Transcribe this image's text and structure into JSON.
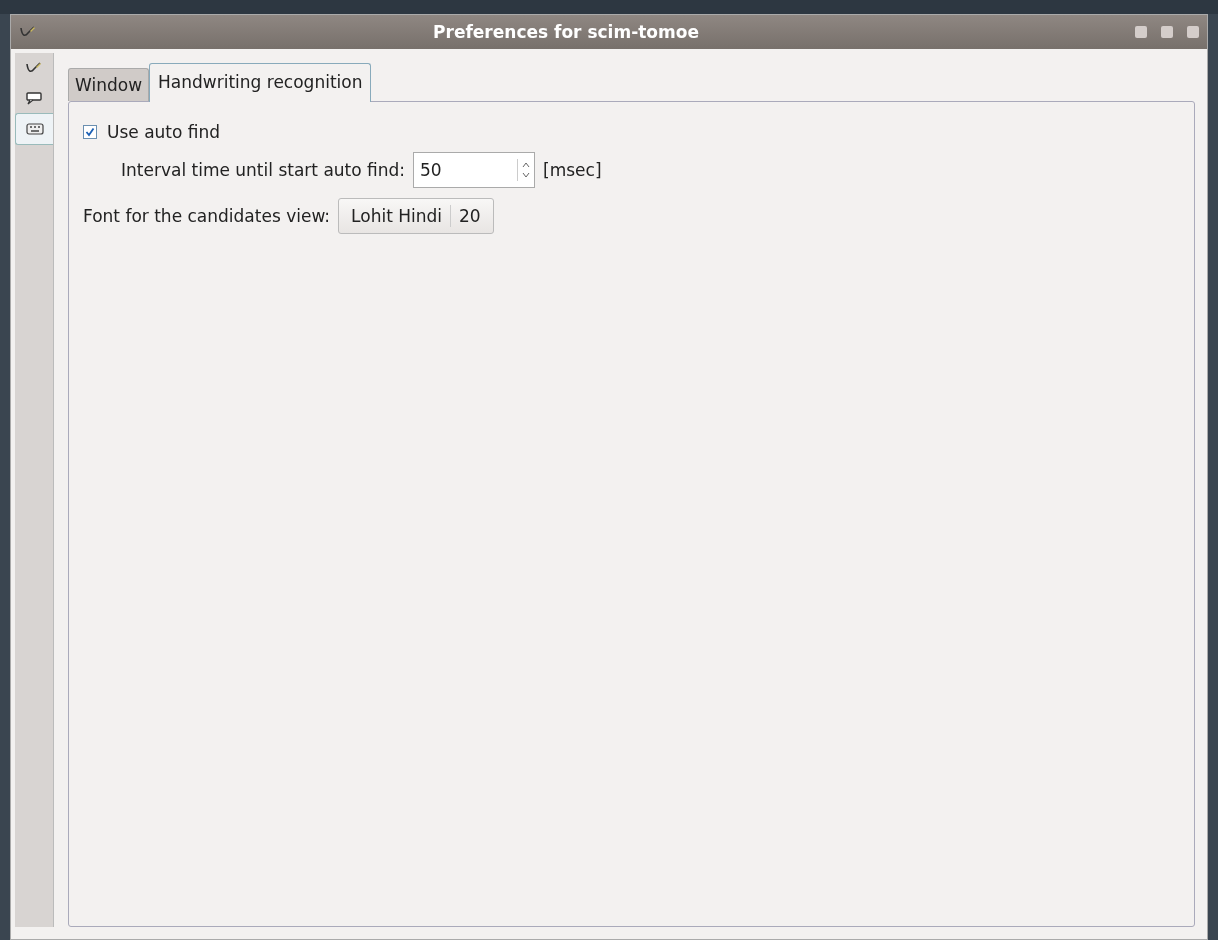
{
  "window": {
    "title": "Preferences for scim-tomoe"
  },
  "side_tabs": [
    {
      "kind": "pen",
      "selected": false
    },
    {
      "kind": "balloon",
      "selected": false
    },
    {
      "kind": "keyboard",
      "selected": true
    }
  ],
  "tabs": [
    {
      "label": "Window",
      "selected": false
    },
    {
      "label": "Handwriting recognition",
      "selected": true
    }
  ],
  "auto_find": {
    "label": "Use auto find",
    "checked": true
  },
  "interval": {
    "label": "Interval time until start auto find:",
    "value": "50",
    "unit": "[msec]"
  },
  "font": {
    "label": "Font for the candidates view:",
    "name": "Lohit Hindi",
    "size": "20"
  }
}
